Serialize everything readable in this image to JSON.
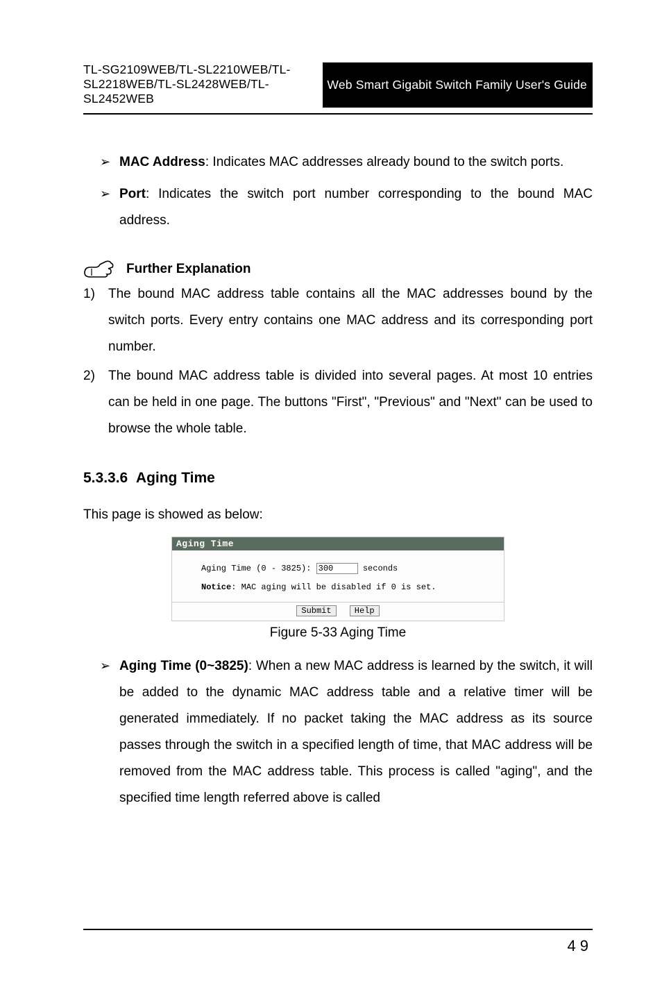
{
  "header": {
    "left": "TL-SG2109WEB/TL-SL2210WEB/TL-SL2218WEB/TL-SL2428WEB/TL-SL2452WEB",
    "right": "Web Smart Gigabit Switch Family User's Guide"
  },
  "bullets": [
    {
      "term": "MAC Address",
      "desc": ": Indicates MAC addresses already bound to the switch ports."
    },
    {
      "term": "Port",
      "desc": ": Indicates the switch port number corresponding to the bound MAC address."
    }
  ],
  "fe_title": "Further Explanation",
  "num_items": [
    "The bound MAC address table contains all the MAC addresses bound by the switch ports. Every entry contains one MAC address and its corresponding port number.",
    "The bound MAC address table is divided into several pages. At most 10 entries can be held in one page. The buttons \"First\", \"Previous\" and \"Next\" can be used to browse the whole table."
  ],
  "section": {
    "number": "5.3.3.6",
    "title": "Aging Time"
  },
  "lead": "This page is showed as below:",
  "panel": {
    "title": "Aging Time",
    "label": "Aging Time (0 - 3825):",
    "value": "300",
    "unit": "seconds",
    "notice_prefix": "Notice",
    "notice_text": ": MAC aging will be disabled if 0 is set.",
    "submit": "Submit",
    "help": "Help"
  },
  "figure_caption": "Figure 5-33  Aging Time",
  "aging_bullet": {
    "term": "Aging Time (0~3825)",
    "desc": ": When a new MAC address is learned by the switch, it will be added to the dynamic MAC address table and a relative timer will be generated immediately. If no packet taking the MAC address as its source passes through the switch in a specified length of time, that MAC address will be removed from the MAC address table. This process is called \"aging\", and the specified time length referred above is called"
  },
  "page_number": "49"
}
